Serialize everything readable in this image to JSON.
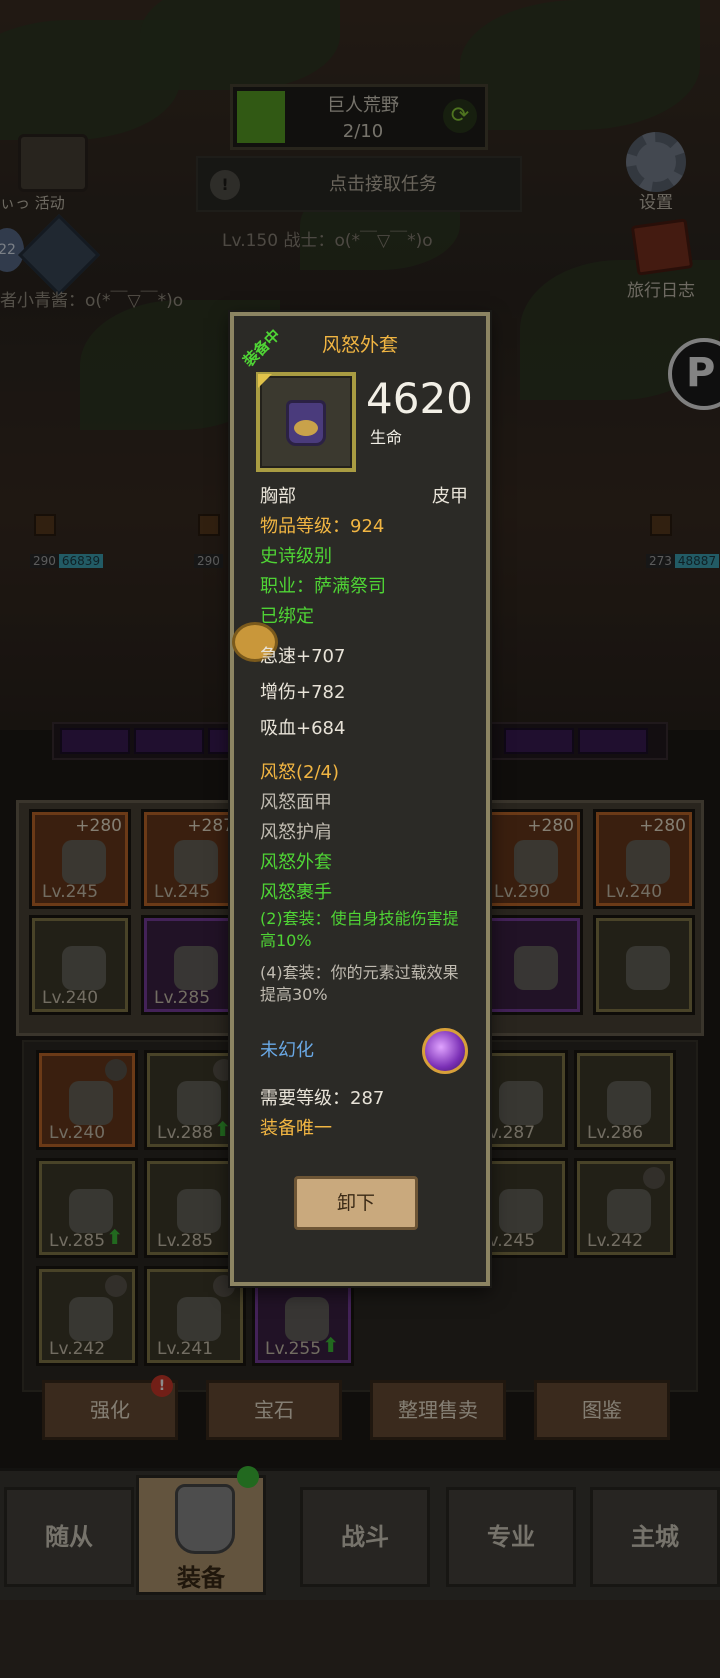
{
  "quest": {
    "zone_name": "巨人荒野",
    "progress_text": "2/10",
    "progress_fraction": 0.2,
    "refresh_icon": "refresh-icon"
  },
  "task": {
    "label": "点击接取任务",
    "icon": "alert-icon"
  },
  "player": {
    "line": "Lv.150 战士：o(*￣▽￣*)o"
  },
  "activities": {
    "label": "ぃっ 活动"
  },
  "ally": {
    "badge": "22",
    "line": "者小青酱：o(*￣▽￣*)o"
  },
  "top_right": {
    "settings_label": "设置",
    "diary_label": "旅行日志"
  },
  "battle_tags": [
    {
      "level": "290",
      "value": "66839"
    },
    {
      "level": "290",
      "value": ""
    },
    {
      "level": "273",
      "value": "48887"
    }
  ],
  "equipped_slots": [
    {
      "plus": "+280",
      "level": "Lv.245",
      "rarity": "orange",
      "item_icon": "necklace-icon"
    },
    {
      "plus": "+287",
      "level": "Lv.245",
      "rarity": "orange",
      "item_icon": "bracer-icon"
    },
    {
      "plus": "+280",
      "level": "Lv.290",
      "rarity": "orange",
      "item_icon": "staff-icon"
    },
    {
      "plus": "+280",
      "level": "Lv.240",
      "rarity": "orange",
      "item_icon": "totem-icon"
    },
    {
      "plus": "",
      "level": "Lv.240",
      "rarity": "olive",
      "item_icon": "amulet-icon"
    },
    {
      "plus": "",
      "level": "Lv.285",
      "rarity": "purple",
      "item_icon": "belt-icon"
    },
    {
      "plus": "",
      "level": "",
      "rarity": "purple",
      "item_icon": "orb-icon"
    },
    {
      "plus": "",
      "level": "",
      "rarity": "olive",
      "item_icon": "bow-icon"
    }
  ],
  "bag_slots": [
    {
      "level": "Lv.240",
      "rarity": "orange",
      "locked": true,
      "up": false
    },
    {
      "level": "Lv.288",
      "rarity": "olive",
      "locked": true,
      "up": true
    },
    {
      "level": "Lv.287",
      "rarity": "olive",
      "locked": false,
      "up": false
    },
    {
      "level": "Lv.286",
      "rarity": "olive",
      "locked": false,
      "up": false
    },
    {
      "level": "Lv.285",
      "rarity": "olive",
      "locked": false,
      "up": true
    },
    {
      "level": "Lv.285",
      "rarity": "olive",
      "locked": false,
      "up": false
    },
    {
      "level": "Lv.245",
      "rarity": "olive",
      "locked": false,
      "up": false
    },
    {
      "level": "Lv.242",
      "rarity": "olive",
      "locked": true,
      "up": false
    },
    {
      "level": "Lv.242",
      "rarity": "olive",
      "locked": true,
      "up": false
    },
    {
      "level": "Lv.241",
      "rarity": "olive",
      "locked": true,
      "up": false
    },
    {
      "level": "Lv.255",
      "rarity": "purple",
      "locked": false,
      "up": true
    }
  ],
  "func_buttons": {
    "enhance": "强化",
    "enhance_badge": "!",
    "gem": "宝石",
    "sort_sell": "整理售卖",
    "codex": "图鉴"
  },
  "tabs": {
    "followers": "随从",
    "equipment": "装备",
    "battle": "战斗",
    "profession": "专业",
    "main_city": "主城"
  },
  "tooltip": {
    "equipped_tag": "装备中",
    "name": "风怒外套",
    "main_stat_value": "4620",
    "main_stat_label": "生命",
    "slot": "胸部",
    "armor_type": "皮甲",
    "item_level": "物品等级：924",
    "rarity": "史诗级别",
    "class": "职业：萨满祭司",
    "bound": "已绑定",
    "stats": [
      "急速+707",
      "增伤+782",
      "吸血+684"
    ],
    "set_title": "风怒(2/4)",
    "set_pieces": [
      {
        "name": "风怒面甲",
        "owned": false
      },
      {
        "name": "风怒护肩",
        "owned": false
      },
      {
        "name": "风怒外套",
        "owned": true
      },
      {
        "name": "风怒裹手",
        "owned": true
      }
    ],
    "set_bonus_2": "(2)套装：使自身技能伤害提高10%",
    "set_bonus_4": "(4)套装：你的元素过载效果提高30%",
    "transmog": "未幻化",
    "required_level": "需要等级：287",
    "unique": "装备唯一",
    "unequip_button": "卸下"
  },
  "colors": {
    "gold": "#f1b542",
    "green": "#4fd435",
    "blue": "#6aa9e6",
    "tooltip_border": "#8c8462"
  }
}
